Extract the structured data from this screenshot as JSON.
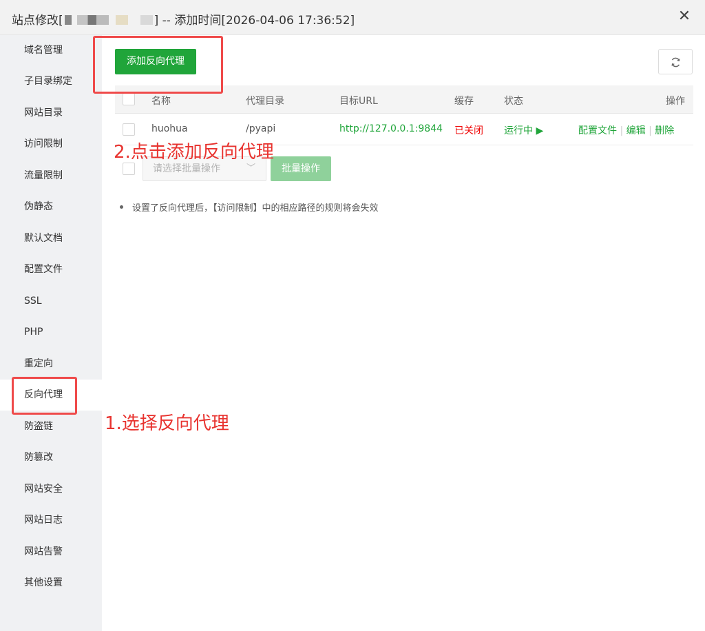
{
  "title": {
    "prefix": "站点修改[",
    "suffix": "] -- 添加时间[2026-04-06 17:36:52]"
  },
  "close_icon_glyph": "✕",
  "sidebar": {
    "items": [
      {
        "label": "域名管理"
      },
      {
        "label": "子目录绑定"
      },
      {
        "label": "网站目录"
      },
      {
        "label": "访问限制"
      },
      {
        "label": "流量限制"
      },
      {
        "label": "伪静态"
      },
      {
        "label": "默认文档"
      },
      {
        "label": "配置文件"
      },
      {
        "label": "SSL"
      },
      {
        "label": "PHP"
      },
      {
        "label": "重定向"
      },
      {
        "label": "反向代理",
        "active": true
      },
      {
        "label": "防盗链"
      },
      {
        "label": "防篡改"
      },
      {
        "label": "网站安全"
      },
      {
        "label": "网站日志"
      },
      {
        "label": "网站告警"
      },
      {
        "label": "其他设置"
      }
    ]
  },
  "toolbar": {
    "add_label": "添加反向代理",
    "refresh_icon": "refresh-icon"
  },
  "table": {
    "columns": [
      "名称",
      "代理目录",
      "目标URL",
      "缓存",
      "状态",
      "操作"
    ],
    "rows": [
      {
        "name": "huohua",
        "dir": "/pyapi",
        "url": "http://127.0.0.1:9844",
        "cache": "已关闭",
        "status": "运行中 ▶",
        "actions": [
          "配置文件",
          "编辑",
          "删除"
        ]
      }
    ]
  },
  "batch": {
    "select_placeholder": "请选择批量操作",
    "chevron": "﹀",
    "button_label": "批量操作"
  },
  "tips": [
    "设置了反向代理后，【访问限制】中的相应路径的规则将会失效"
  ],
  "annotations": {
    "step1": "1.选择反向代理",
    "step2": "2.点击添加反向代理"
  },
  "colors": {
    "brand_green": "#20a53a",
    "danger_red": "#ef0808",
    "annotation_red": "#e8332f"
  }
}
